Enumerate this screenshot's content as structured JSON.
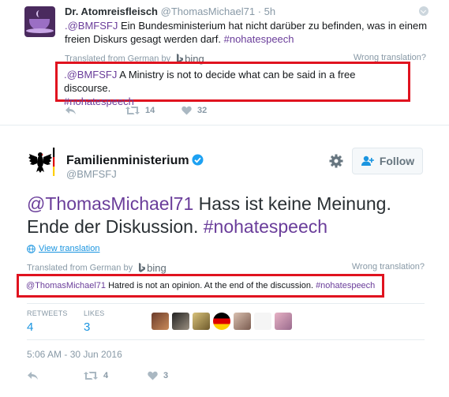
{
  "reply": {
    "display_name": "Dr. Atomreisfleisch",
    "handle": "@ThomasMichael71",
    "time_sep": "·",
    "time": "5h",
    "text_mention": ".@BMFSFJ",
    "text_body": " Ein Bundesministerium hat nicht darüber zu befinden, was in einem freien Diskurs gesagt werden darf. ",
    "text_hashtag": "#nohatespeech",
    "translated_from": "Translated from German by",
    "bing": "bing",
    "wrong_translation": "Wrong translation?",
    "trans_mention": ".@BMFSFJ",
    "trans_body": " A Ministry is not to decide what can be said in a free discourse. ",
    "trans_hashtag": "#nohatespeech",
    "retweets": "14",
    "likes": "32"
  },
  "main": {
    "display_name": "Familienministerium",
    "handle": "@BMFSFJ",
    "follow_label": "Follow",
    "text_mention": "@ThomasMichael71",
    "text_body": " Hass ist keine Meinung. Ende der Diskussion. ",
    "text_hashtag": "#nohatespeech",
    "view_translation": "View translation",
    "translated_from": "Translated from German by",
    "bing": "bing",
    "wrong_translation": "Wrong translation?",
    "trans_mention": "@ThomasMichael71",
    "trans_body": " Hatred is not an opinion. At the end of the discussion. ",
    "trans_hashtag": "#nohatespeech",
    "retweets_label": "RETWEETS",
    "retweets": "4",
    "likes_label": "LIKES",
    "likes": "3",
    "timestamp": "5:06 AM - 30 Jun 2016",
    "action_retweets": "4",
    "action_likes": "3"
  },
  "colors": {
    "link": "#1b95e0",
    "hashtag": "#6a3d9a",
    "highlight_box": "#e0131f",
    "verified": "#1da1f2"
  },
  "icons": [
    "reply-icon",
    "retweet-icon",
    "heart-icon",
    "more-icon",
    "gear-icon",
    "add-user-icon",
    "verified-icon",
    "globe-icon",
    "bing-logo-icon",
    "eagle-logo-icon"
  ]
}
